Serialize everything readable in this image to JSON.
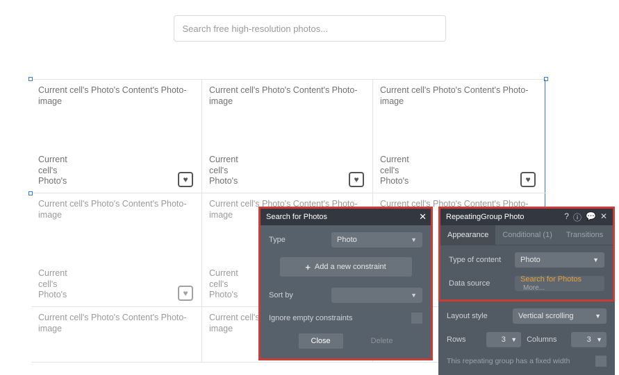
{
  "search": {
    "placeholder": "Search free high-resolution photos..."
  },
  "grid": {
    "cell_label": "Current cell's Photo's Content's Photo-image",
    "bottom_label": "Current cell's Photo's"
  },
  "popup_search": {
    "title": "Search for Photos",
    "type_label": "Type",
    "type_value": "Photo",
    "add_constraint": "Add a new constraint",
    "sort_label": "Sort by",
    "ignore_label": "Ignore empty constraints",
    "close_btn": "Close",
    "delete_btn": "Delete"
  },
  "popup_rg": {
    "title": "RepeatingGroup Photo",
    "tabs": {
      "appearance": "Appearance",
      "conditional": "Conditional (1)",
      "transitions": "Transitions"
    },
    "type_label": "Type of content",
    "type_value": "Photo",
    "ds_label": "Data source",
    "ds_value": "Search for Photos",
    "ds_more": "More...",
    "layout_label": "Layout style",
    "layout_value": "Vertical scrolling",
    "rows_label": "Rows",
    "rows_value": "3",
    "cols_label": "Columns",
    "cols_value": "3",
    "note": "This repeating group has a fixed width"
  }
}
